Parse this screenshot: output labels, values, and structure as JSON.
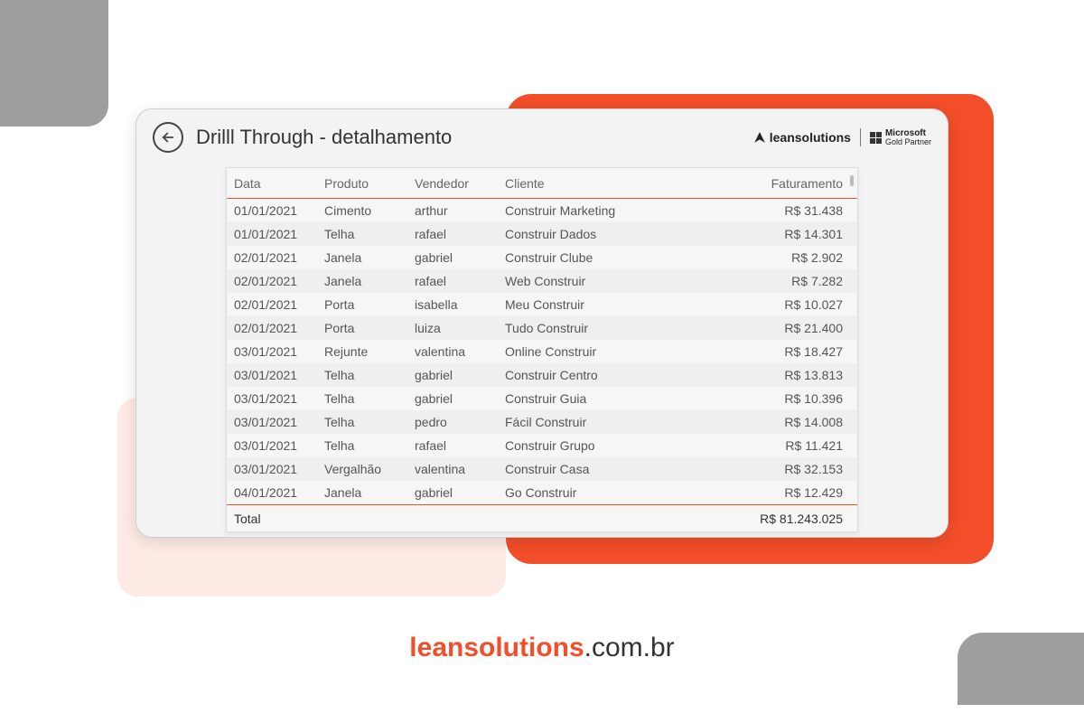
{
  "header": {
    "title": "Drilll Through - detalhamento",
    "logo1": "leansolutions",
    "logo2_line1": "Microsoft",
    "logo2_line2": "Gold Partner"
  },
  "table": {
    "columns": [
      "Data",
      "Produto",
      "Vendedor",
      "Cliente",
      "Faturamento"
    ],
    "rows": [
      {
        "data": "01/01/2021",
        "produto": "Cimento",
        "vendedor": "arthur",
        "cliente": "Construir Marketing",
        "fat": "R$ 31.438"
      },
      {
        "data": "01/01/2021",
        "produto": "Telha",
        "vendedor": "rafael",
        "cliente": "Construir Dados",
        "fat": "R$ 14.301"
      },
      {
        "data": "02/01/2021",
        "produto": "Janela",
        "vendedor": "gabriel",
        "cliente": "Construir Clube",
        "fat": "R$ 2.902"
      },
      {
        "data": "02/01/2021",
        "produto": "Janela",
        "vendedor": "rafael",
        "cliente": "Web Construir",
        "fat": "R$ 7.282"
      },
      {
        "data": "02/01/2021",
        "produto": "Porta",
        "vendedor": "isabella",
        "cliente": "Meu Construir",
        "fat": "R$ 10.027"
      },
      {
        "data": "02/01/2021",
        "produto": "Porta",
        "vendedor": "luiza",
        "cliente": "Tudo Construir",
        "fat": "R$ 21.400"
      },
      {
        "data": "03/01/2021",
        "produto": "Rejunte",
        "vendedor": "valentina",
        "cliente": "Online Construir",
        "fat": "R$ 18.427"
      },
      {
        "data": "03/01/2021",
        "produto": "Telha",
        "vendedor": "gabriel",
        "cliente": "Construir Centro",
        "fat": "R$ 13.813"
      },
      {
        "data": "03/01/2021",
        "produto": "Telha",
        "vendedor": "gabriel",
        "cliente": "Construir Guia",
        "fat": "R$ 10.396"
      },
      {
        "data": "03/01/2021",
        "produto": "Telha",
        "vendedor": "pedro",
        "cliente": "Fácil Construir",
        "fat": "R$ 14.008"
      },
      {
        "data": "03/01/2021",
        "produto": "Telha",
        "vendedor": "rafael",
        "cliente": "Construir Grupo",
        "fat": "R$ 11.421"
      },
      {
        "data": "03/01/2021",
        "produto": "Vergalhão",
        "vendedor": "valentina",
        "cliente": "Construir Casa",
        "fat": "R$ 32.153"
      },
      {
        "data": "04/01/2021",
        "produto": "Janela",
        "vendedor": "gabriel",
        "cliente": "Go Construir",
        "fat": "R$ 12.429"
      }
    ],
    "total_label": "Total",
    "total_value": "R$ 81.243.025"
  },
  "footer": {
    "brand_bold": "leansolutions",
    "brand_rest": ".com.br"
  }
}
